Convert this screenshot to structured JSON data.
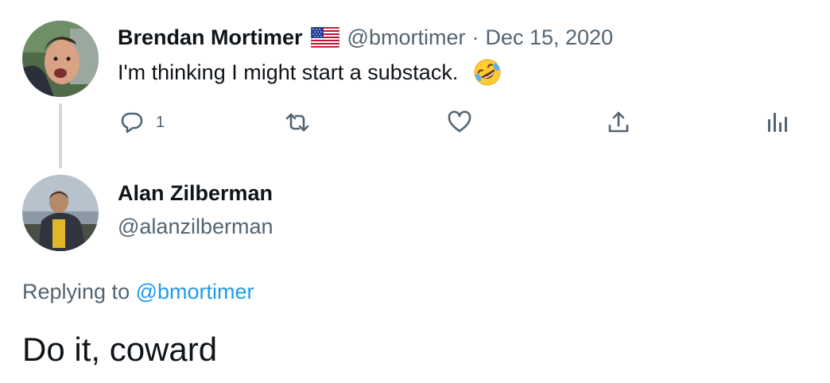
{
  "tweet": {
    "author_name": "Brendan Mortimer",
    "flag_icon": "us-flag-icon",
    "handle": "@bmortimer",
    "separator": "·",
    "date": "Dec 15, 2020",
    "text": "I'm thinking I might start a substack.",
    "emoji": "rolling-on-floor-laughing-emoji",
    "actions": {
      "reply_icon": "reply-icon",
      "reply_count": "1",
      "retweet_icon": "retweet-icon",
      "like_icon": "heart-icon",
      "share_icon": "share-icon",
      "analytics_icon": "analytics-icon"
    }
  },
  "reply": {
    "author_name": "Alan Zilberman",
    "handle": "@alanzilberman",
    "replying_prefix": "Replying to",
    "replying_to": "@bmortimer",
    "text": "Do it, coward"
  },
  "colors": {
    "primary_text": "#0f1419",
    "secondary_text": "#536471",
    "link": "#1d9bf0",
    "thread_line": "#cfd9de"
  }
}
